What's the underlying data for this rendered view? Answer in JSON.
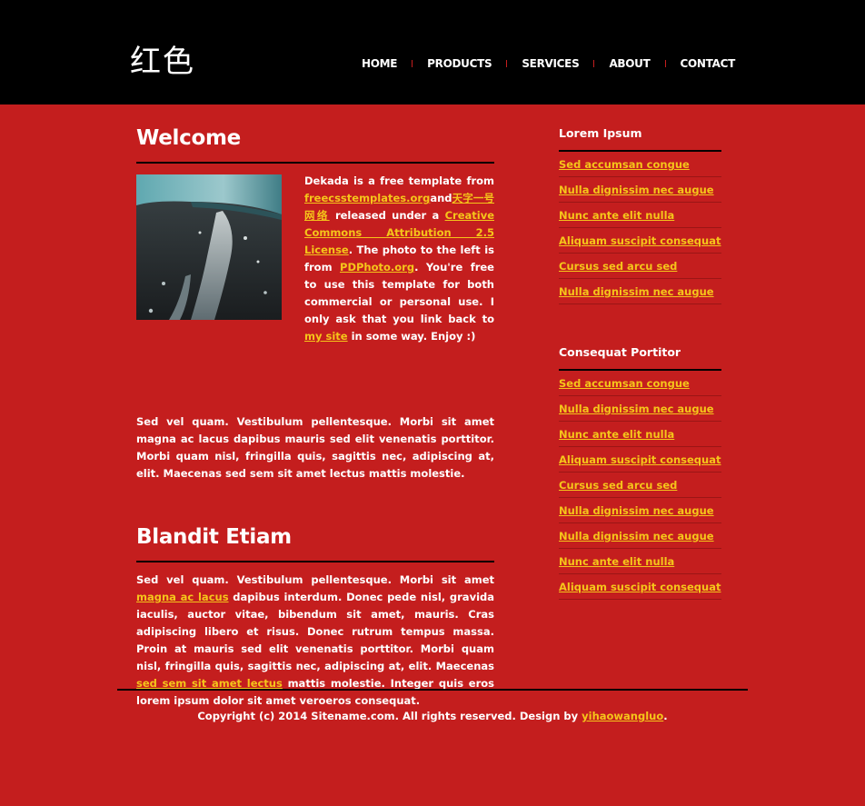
{
  "header": {
    "logo": "红色",
    "menu": [
      "HOME",
      "PRODUCTS",
      "SERVICES",
      "ABOUT",
      "CONTACT"
    ]
  },
  "welcome": {
    "title": "Welcome",
    "intro": {
      "t1": "Dekada is a free template from ",
      "link1": "freecsstemplates.org",
      "t2": "and",
      "link2": "天字一号网络",
      "t3": " released under a ",
      "link3": "Creative Commons Attribution 2.5 License",
      "t4": ". The photo to the left is from ",
      "link4": "PDPhoto.org",
      "t5": ". You're free to use this template for both commercial or personal use. I only ask that you link back to ",
      "link5": "my site",
      "t6": " in some way. Enjoy :)"
    },
    "paragraph": "Sed vel quam. Vestibulum pellentesque. Morbi sit amet magna ac lacus dapibus mauris sed elit venenatis porttitor. Morbi quam nisl, fringilla quis, sagittis nec, adipiscing at, elit. Maecenas sed sem sit amet lectus mattis molestie."
  },
  "blandit": {
    "title": "Blandit Etiam",
    "t1": "Sed vel quam. Vestibulum pellentesque. Morbi sit amet ",
    "link1": "magna ac lacus",
    "t2": " dapibus interdum. Donec pede nisl, gravida iaculis, auctor vitae, bibendum sit amet, mauris. Cras adipiscing libero et risus. Donec rutrum tempus massa. Proin at mauris sed elit venenatis porttitor. Morbi quam nisl, fringilla quis, sagittis nec, adipiscing at, elit. Maecenas ",
    "link2": "sed sem sit amet lectus",
    "t3": " mattis molestie. Integer quis eros lorem ipsum dolor sit amet veroeros consequat."
  },
  "sidebar": {
    "sections": [
      {
        "title": "Lorem Ipsum",
        "links": [
          "Sed accumsan congue",
          "Nulla dignissim nec augue",
          "Nunc ante elit nulla",
          "Aliquam suscipit consequat",
          "Cursus sed arcu sed",
          "Nulla dignissim nec augue"
        ]
      },
      {
        "title": "Consequat Portitor",
        "links": [
          "Sed accumsan congue",
          "Nulla dignissim nec augue",
          "Nunc ante elit nulla",
          "Aliquam suscipit consequat",
          "Cursus sed arcu sed",
          "Nulla dignissim nec augue",
          "Nulla dignissim nec augue",
          "Nunc ante elit nulla",
          "Aliquam suscipit consequat"
        ]
      }
    ]
  },
  "footer": {
    "t1": "Copyright (c) 2014 Sitename.com. All rights reserved. Design by ",
    "link": "yihaowangluo",
    "t2": "."
  },
  "colors": {
    "background": "#c41e1e",
    "header": "#000000",
    "link": "#f5c51a",
    "text": "#ffffff"
  },
  "icons": {
    "welcome_photo": "water-fountain-photo"
  }
}
